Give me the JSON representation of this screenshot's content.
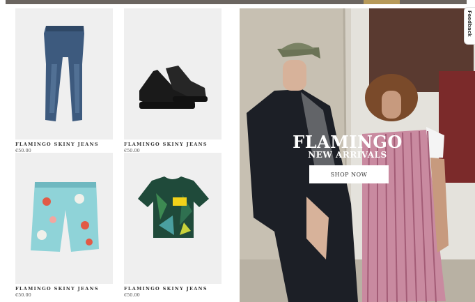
{
  "products": [
    {
      "name": "FLAMINGO SKINY JEANS",
      "price": "€50.00",
      "icon": "jeans"
    },
    {
      "name": "FLAMINGO SKINY JEANS",
      "price": "€50.00",
      "icon": "sneakers"
    },
    {
      "name": "FLAMINGO SKINY JEANS",
      "price": "€50.00",
      "icon": "floral-shorts"
    },
    {
      "name": "FLAMINGO SKINY JEANS",
      "price": "€50.00",
      "icon": "tropical-tshirt"
    }
  ],
  "hero": {
    "title": "FLAMINGO",
    "subtitle": "NEW ARRIVALS",
    "button_label": "SHOP NOW"
  },
  "feedback": {
    "label": "Feedback"
  }
}
